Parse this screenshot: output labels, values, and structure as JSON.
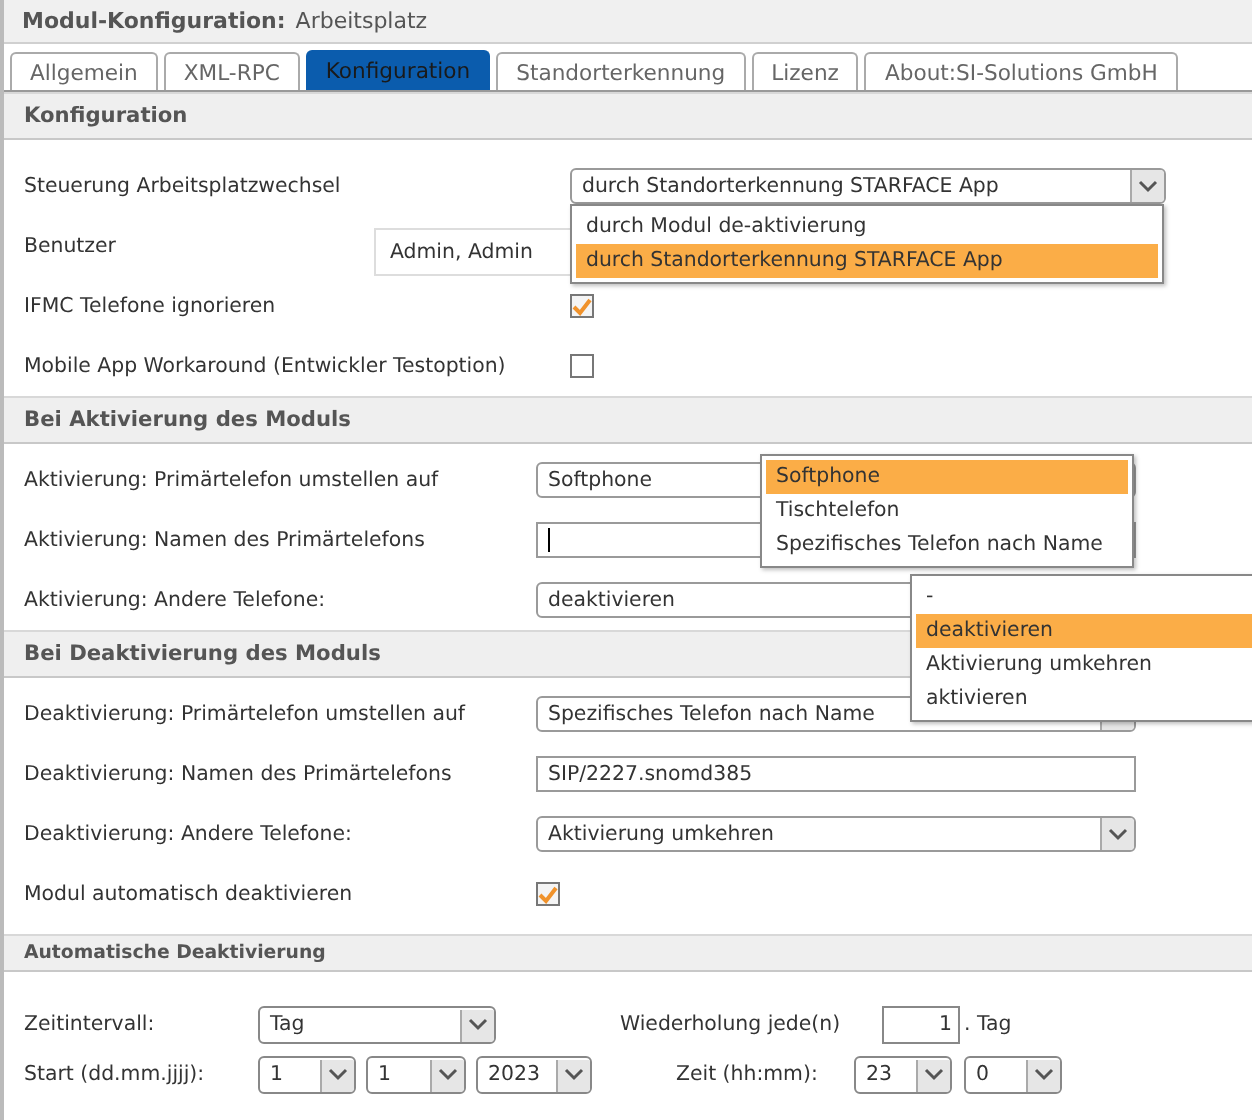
{
  "header": {
    "title": "Modul-Konfiguration:",
    "subtitle": "Arbeitsplatz"
  },
  "tabs": [
    {
      "label": "Allgemein",
      "selected": false
    },
    {
      "label": "XML-RPC",
      "selected": false
    },
    {
      "label": "Konfiguration",
      "selected": true
    },
    {
      "label": "Standorterkennung",
      "selected": false
    },
    {
      "label": "Lizenz",
      "selected": false
    },
    {
      "label": "About:SI-Solutions GmbH",
      "selected": false
    }
  ],
  "sections": [
    {
      "title": "Konfiguration",
      "rows": [
        {
          "kind": "select",
          "label": "Steuerung Arbeitsplatzwechsel",
          "value": "durch Standorterkennung STARFACE App",
          "expanded": true,
          "options": [
            {
              "label": "durch Modul de-aktivierung",
              "selected": false
            },
            {
              "label": "durch Standorterkennung STARFACE App",
              "selected": true
            }
          ]
        },
        {
          "kind": "text",
          "label": "Benutzer",
          "value": "Admin, Admin"
        },
        {
          "kind": "checkbox",
          "label": "IFMC Telefone ignorieren",
          "checked": true
        },
        {
          "kind": "checkbox",
          "label": "Mobile App Workaround (Entwickler Testoption)",
          "checked": false
        }
      ]
    },
    {
      "title": "Bei Aktivierung des Moduls",
      "rows": [
        {
          "kind": "select",
          "label": "Aktivierung: Primärtelefon umstellen auf",
          "value": "Softphone",
          "expanded": true,
          "options": [
            {
              "label": "Softphone",
              "selected": true
            },
            {
              "label": "Tischtelefon",
              "selected": false
            },
            {
              "label": "Spezifisches Telefon nach Name",
              "selected": false
            }
          ]
        },
        {
          "kind": "text",
          "label": "Aktivierung: Namen des Primärtelefons",
          "focused": true
        },
        {
          "kind": "select",
          "label": "Aktivierung: Andere Telefone:",
          "value": "deaktivieren",
          "expanded": true,
          "options": [
            {
              "label": "-",
              "selected": false
            },
            {
              "label": "deaktivieren",
              "selected": true
            },
            {
              "label": "Aktivierung umkehren",
              "selected": false
            },
            {
              "label": "aktivieren",
              "selected": false
            }
          ]
        }
      ]
    },
    {
      "title": "Bei Deaktivierung des Moduls",
      "rows": [
        {
          "kind": "select",
          "label": "Deaktivierung: Primärtelefon umstellen auf",
          "value": "Spezifisches Telefon nach Name",
          "expanded": false
        },
        {
          "kind": "text",
          "label": "Deaktivierung: Namen des Primärtelefons",
          "value": "SIP/2227.snomd385"
        },
        {
          "kind": "select",
          "label": "Deaktivierung: Andere Telefone:",
          "value": "Aktivierung umkehren",
          "expanded": false
        },
        {
          "kind": "checkbox",
          "label": "Modul automatisch deaktivieren",
          "checked": true
        }
      ]
    }
  ],
  "schedule": {
    "title": "Automatische Deaktivierung",
    "lines": [
      {
        "items": [
          {
            "kind": "label",
            "text": "Zeitintervall:"
          },
          {
            "kind": "select",
            "value": "Tag"
          },
          {
            "kind": "label",
            "text": "Wiederholung jede(n)"
          },
          {
            "kind": "number",
            "value": "1"
          },
          {
            "kind": "label",
            "text": ". Tag"
          }
        ]
      },
      {
        "items": [
          {
            "kind": "label",
            "text": "Start (dd.mm.jjjj):"
          },
          {
            "kind": "select",
            "value": "1"
          },
          {
            "kind": "select",
            "value": "1"
          },
          {
            "kind": "select",
            "value": "2023"
          },
          {
            "kind": "label",
            "text": "Zeit (hh:mm):"
          },
          {
            "kind": "select",
            "value": "23"
          },
          {
            "kind": "select",
            "value": "0"
          }
        ]
      }
    ]
  }
}
